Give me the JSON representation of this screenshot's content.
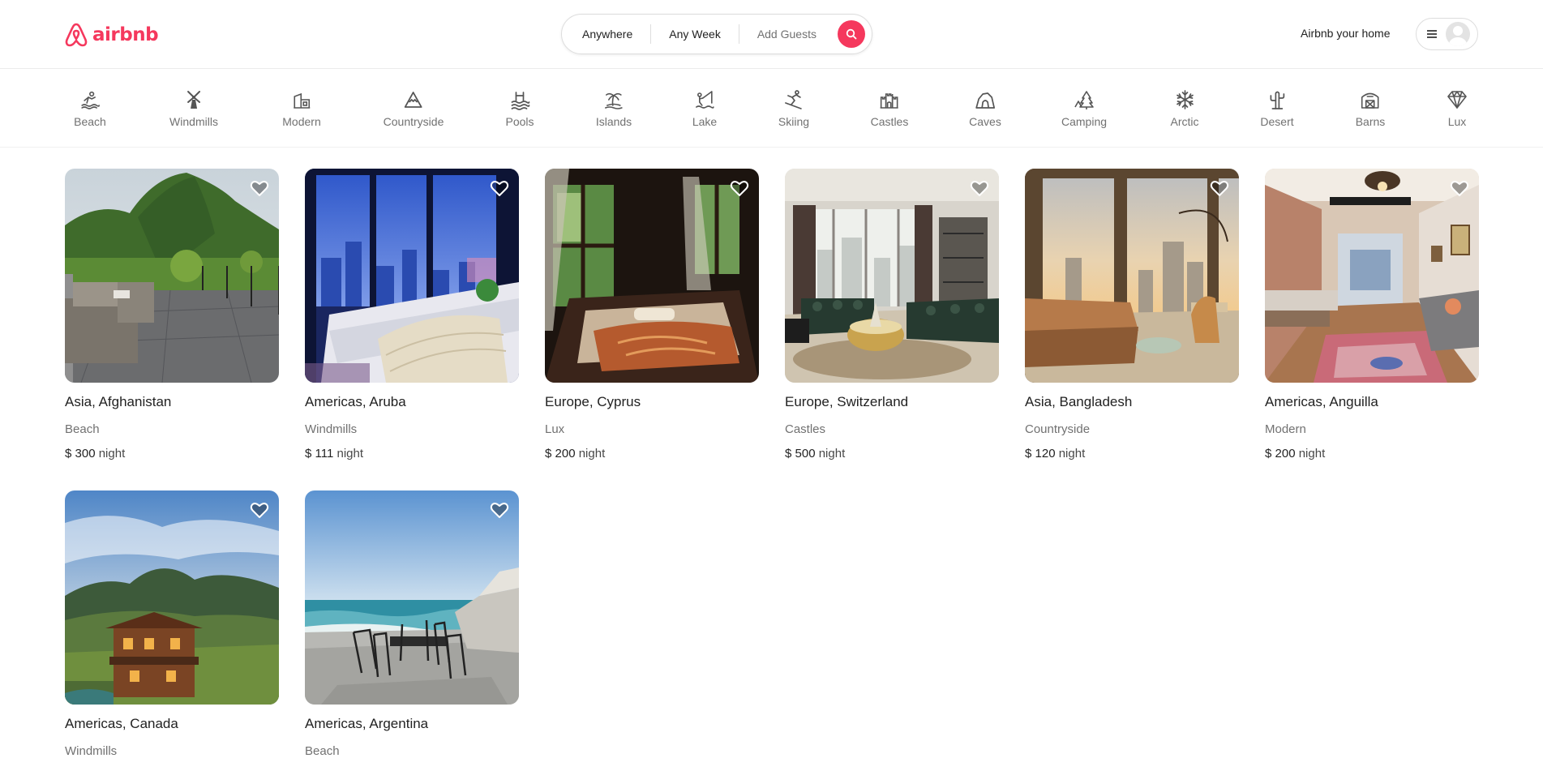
{
  "brand": {
    "name": "airbnb",
    "color": "#f5385d"
  },
  "search": {
    "where": "Anywhere",
    "when": "Any Week",
    "guests": "Add Guests",
    "button_icon": "search-icon"
  },
  "header": {
    "host_link": "Airbnb your home",
    "menu_icon": "hamburger-icon",
    "avatar_icon": "user-avatar-icon"
  },
  "categories": [
    {
      "label": "Beach",
      "icon": "beach-icon"
    },
    {
      "label": "Windmills",
      "icon": "windmill-icon"
    },
    {
      "label": "Modern",
      "icon": "modern-house-icon"
    },
    {
      "label": "Countryside",
      "icon": "mountain-icon"
    },
    {
      "label": "Pools",
      "icon": "pool-icon"
    },
    {
      "label": "Islands",
      "icon": "island-icon"
    },
    {
      "label": "Lake",
      "icon": "lake-fishing-icon"
    },
    {
      "label": "Skiing",
      "icon": "skiing-icon"
    },
    {
      "label": "Castles",
      "icon": "castle-icon"
    },
    {
      "label": "Caves",
      "icon": "cave-icon"
    },
    {
      "label": "Camping",
      "icon": "camping-icon"
    },
    {
      "label": "Arctic",
      "icon": "snowflake-icon"
    },
    {
      "label": "Desert",
      "icon": "cactus-icon"
    },
    {
      "label": "Barns",
      "icon": "barn-icon"
    },
    {
      "label": "Lux",
      "icon": "diamond-icon"
    }
  ],
  "listings": [
    {
      "location": "Asia, Afghanistan",
      "category": "Beach",
      "price": "$ 300",
      "unit": "night"
    },
    {
      "location": "Americas, Aruba",
      "category": "Windmills",
      "price": "$ 111",
      "unit": "night"
    },
    {
      "location": "Europe, Cyprus",
      "category": "Lux",
      "price": "$ 200",
      "unit": "night"
    },
    {
      "location": "Europe, Switzerland",
      "category": "Castles",
      "price": "$ 500",
      "unit": "night"
    },
    {
      "location": "Asia, Bangladesh",
      "category": "Countryside",
      "price": "$ 120",
      "unit": "night"
    },
    {
      "location": "Americas, Anguilla",
      "category": "Modern",
      "price": "$ 200",
      "unit": "night"
    },
    {
      "location": "Americas, Canada",
      "category": "Windmills"
    },
    {
      "location": "Americas, Argentina",
      "category": "Beach"
    }
  ]
}
